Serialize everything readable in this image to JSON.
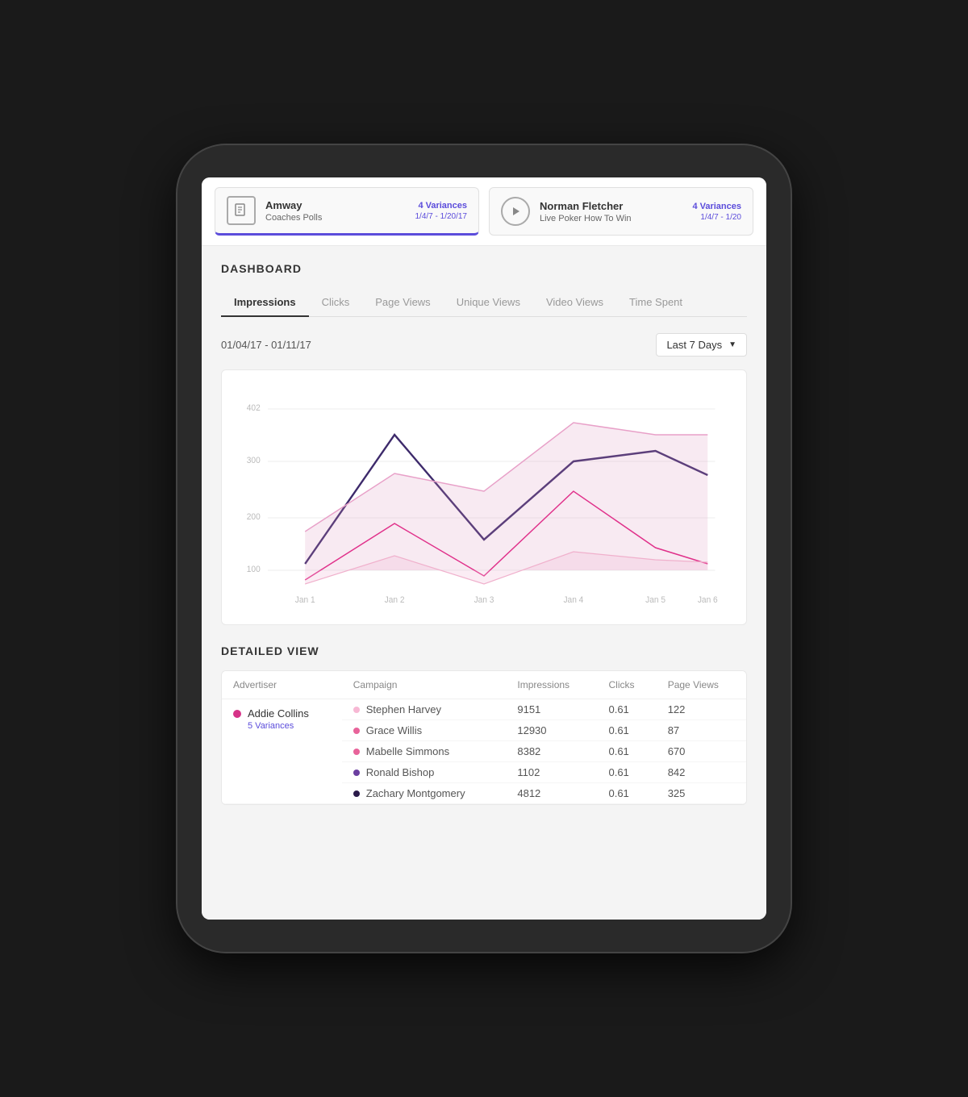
{
  "tablet": {
    "cards": [
      {
        "id": "amway",
        "icon_type": "document",
        "title": "Amway",
        "subtitle": "Coaches Polls",
        "variances": "4 Variances",
        "date_range": "1/4/7 - 1/20/17",
        "selected": true
      },
      {
        "id": "norman",
        "icon_type": "play",
        "title": "Norman Fletcher",
        "subtitle": "Live Poker How To Win",
        "variances": "4 Variances",
        "date_range": "1/4/7 - 1/20",
        "selected": false
      }
    ]
  },
  "dashboard": {
    "title": "DASHBOARD",
    "tabs": [
      {
        "id": "impressions",
        "label": "Impressions",
        "active": true
      },
      {
        "id": "clicks",
        "label": "Clicks",
        "active": false
      },
      {
        "id": "pageviews",
        "label": "Page Views",
        "active": false
      },
      {
        "id": "uniqueviews",
        "label": "Unique Views",
        "active": false
      },
      {
        "id": "videoviews",
        "label": "Video Views",
        "active": false
      },
      {
        "id": "timespent",
        "label": "Time Spent",
        "active": false
      }
    ],
    "date_range": "01/04/17 - 01/11/17",
    "date_picker_label": "Last 7 Days",
    "chart": {
      "y_labels": [
        "402",
        "300",
        "200",
        "100"
      ],
      "x_labels": [
        "Jan 1",
        "Jan 2",
        "Jan 3",
        "Jan 4",
        "Jan 5",
        "Jan 6"
      ]
    },
    "detailed_view": {
      "title": "DETAILED VIEW",
      "columns": [
        "Advertiser",
        "Campaign",
        "Impressions",
        "Clicks",
        "Page Views"
      ],
      "rows": [
        {
          "advertiser": "Addie Collins",
          "advertiser_color": "#d63388",
          "variances": "5 Variances",
          "campaigns": [
            {
              "name": "Stephen Harvey",
              "color": "#f7b8d4",
              "impressions": "9151",
              "clicks": "0.61",
              "page_views": "122"
            },
            {
              "name": "Grace Willis",
              "color": "#e8639a",
              "impressions": "12930",
              "clicks": "0.61",
              "page_views": "87"
            },
            {
              "name": "Mabelle Simmons",
              "color": "#e8639a",
              "impressions": "8382",
              "clicks": "0.61",
              "page_views": "670"
            },
            {
              "name": "Ronald Bishop",
              "color": "#6b3fa0",
              "impressions": "1102",
              "clicks": "0.61",
              "page_views": "842"
            },
            {
              "name": "Zachary Montgomery",
              "color": "#2a1a4a",
              "impressions": "4812",
              "clicks": "0.61",
              "page_views": "325"
            }
          ]
        }
      ]
    }
  }
}
